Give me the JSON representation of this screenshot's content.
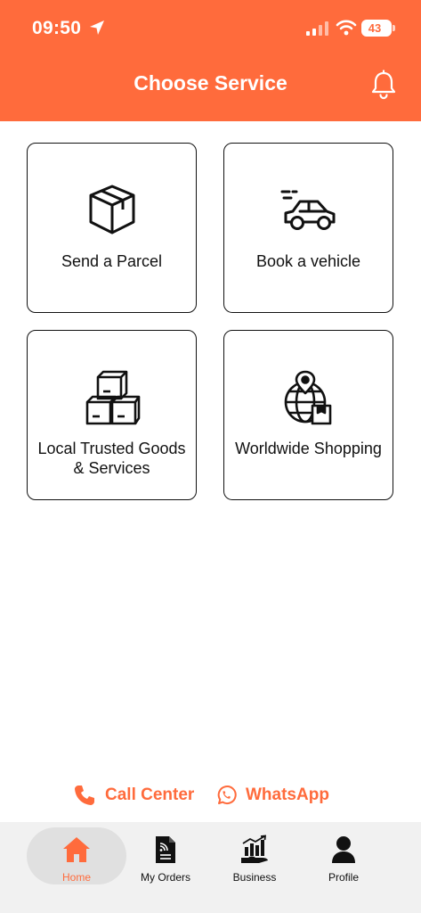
{
  "status_bar": {
    "time": "09:50",
    "battery": "43"
  },
  "header": {
    "title": "Choose Service"
  },
  "services": [
    {
      "label": "Send a Parcel",
      "icon": "parcel-box-icon"
    },
    {
      "label": "Book a vehicle",
      "icon": "car-icon"
    },
    {
      "label": "Local Trusted Goods & Services",
      "icon": "stacked-boxes-icon"
    },
    {
      "label": "Worldwide Shopping",
      "icon": "globe-package-icon"
    }
  ],
  "contacts": {
    "call_center": "Call Center",
    "whatsapp": "WhatsApp"
  },
  "bottom_nav": [
    {
      "label": "Home",
      "icon": "home-icon",
      "active": true
    },
    {
      "label": "My Orders",
      "icon": "orders-document-icon",
      "active": false
    },
    {
      "label": "Business",
      "icon": "business-chart-icon",
      "active": false
    },
    {
      "label": "Profile",
      "icon": "profile-icon",
      "active": false
    }
  ],
  "colors": {
    "accent": "#FF6B3C",
    "nav_background": "#F1F1F1",
    "nav_active_pill": "#E0E0E0"
  }
}
